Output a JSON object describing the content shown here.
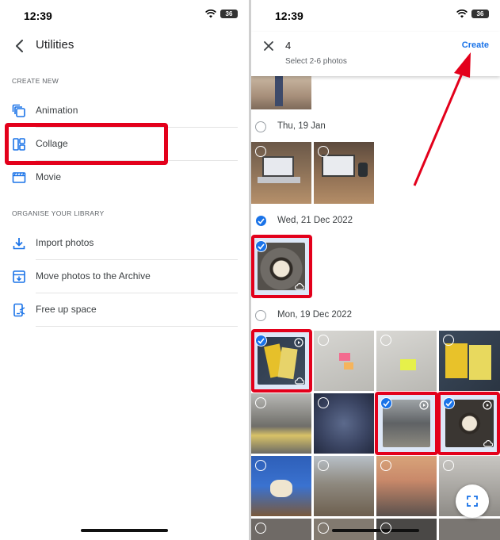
{
  "left": {
    "time": "12:39",
    "battery": "36",
    "title": "Utilities",
    "create_new_label": "CREATE NEW",
    "create_items": [
      {
        "label": "Animation",
        "icon": "animation-icon"
      },
      {
        "label": "Collage",
        "icon": "collage-icon"
      },
      {
        "label": "Movie",
        "icon": "movie-icon"
      }
    ],
    "organise_label": "ORGANISE YOUR LIBRARY",
    "organise_items": [
      {
        "label": "Import photos",
        "icon": "download-icon"
      },
      {
        "label": "Move photos to the Archive",
        "icon": "archive-icon"
      },
      {
        "label": "Free up space",
        "icon": "phone-clean-icon"
      }
    ]
  },
  "right": {
    "time": "12:39",
    "battery": "36",
    "selected_count": "4",
    "hint": "Select 2-6 photos",
    "create_label": "Create",
    "dates": [
      {
        "label": "Thu, 19 Jan",
        "checked": false
      },
      {
        "label": "Wed, 21 Dec 2022",
        "checked": true
      },
      {
        "label": "Mon, 19 Dec 2022",
        "checked": false
      }
    ]
  },
  "colors": {
    "accent": "#1a73e8",
    "highlight": "#e3001b"
  }
}
